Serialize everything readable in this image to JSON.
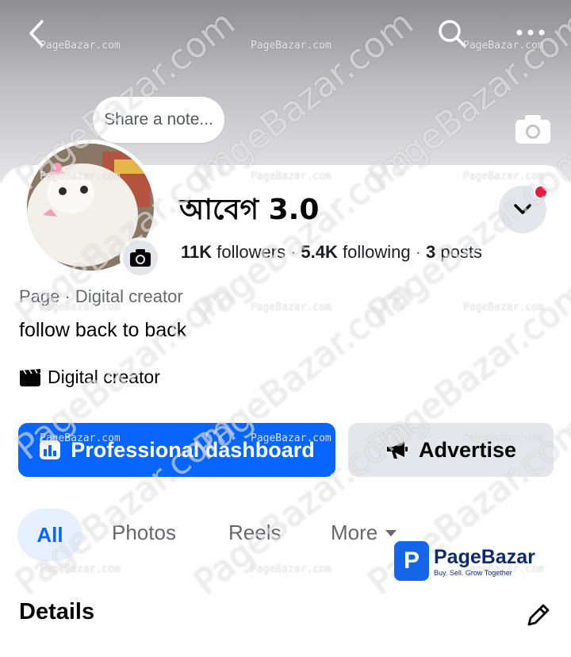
{
  "header": {
    "back_icon": "chevron-left-icon",
    "search_icon": "search-icon",
    "more_icon": "more-horizontal-icon"
  },
  "note": {
    "placeholder": "Share a note..."
  },
  "profile": {
    "name": "আবেগ 3.0",
    "followers_count": "11K",
    "followers_label": "followers",
    "following_count": "5.4K",
    "following_label": "following",
    "posts_count": "3",
    "posts_label": "posts",
    "category": "Page · Digital creator",
    "bio": "follow back to back",
    "creator_label": "Digital creator"
  },
  "actions": {
    "professional_label": "Professional dashboard",
    "advertise_label": "Advertise"
  },
  "tabs": [
    {
      "label": "All",
      "active": true
    },
    {
      "label": "Photos"
    },
    {
      "label": "Reels"
    },
    {
      "label": "More"
    }
  ],
  "section": {
    "details_title": "Details"
  },
  "watermark": {
    "small": "PageBazar.com",
    "large": "PageBazar.com",
    "logo_name": "PageBazar",
    "logo_tagline": "Buy. Sell. Grow Together",
    "logo_letter": "P"
  },
  "colors": {
    "primary": "#0866ff",
    "notification": "#e41e3f",
    "secondary_button": "#e4e6eb"
  }
}
